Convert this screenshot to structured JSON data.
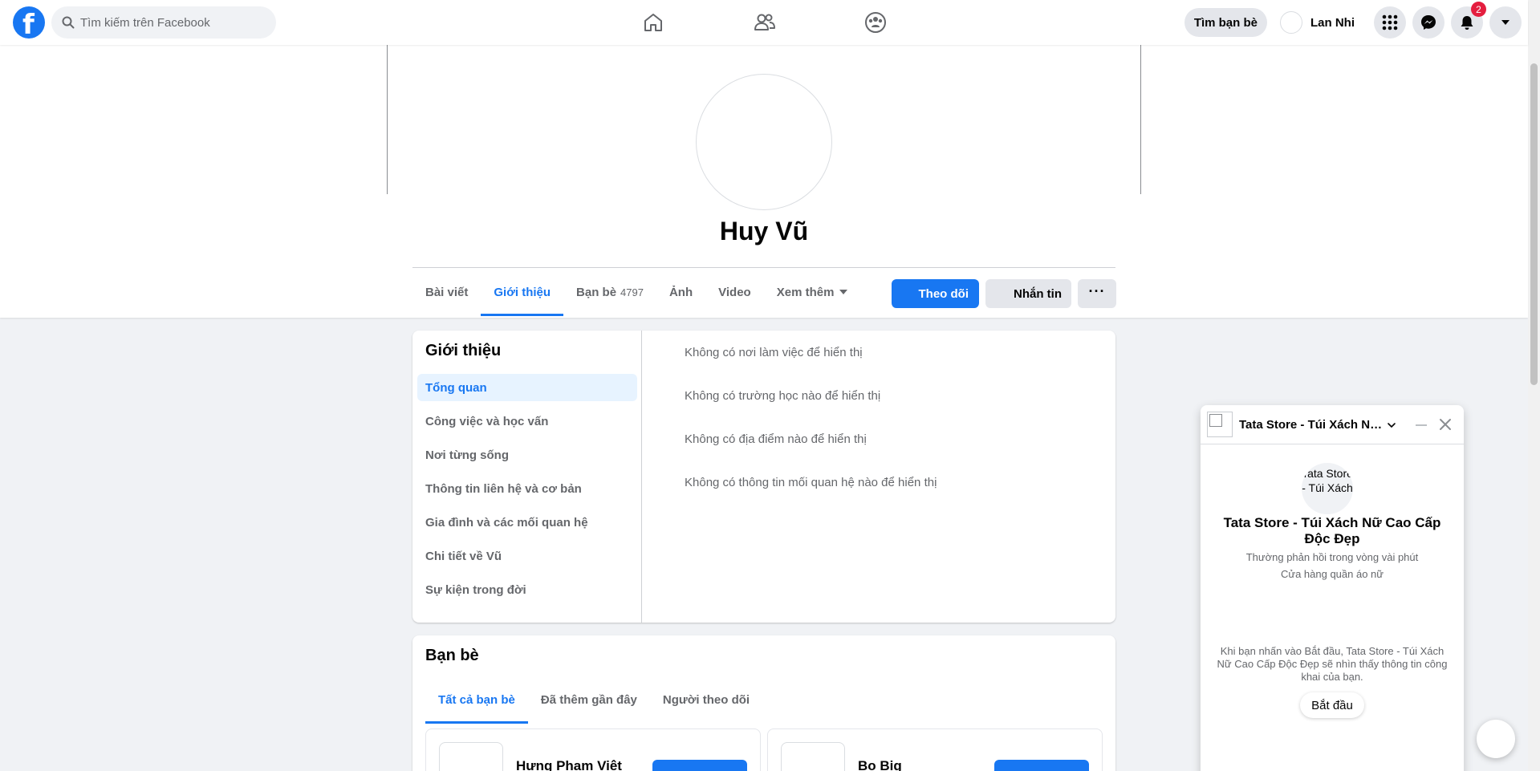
{
  "topbar": {
    "search_placeholder": "Tìm kiếm trên Facebook",
    "find_friends": "Tìm bạn bè",
    "user_name": "Lan Nhi",
    "notifications_count": "2"
  },
  "profile": {
    "name": "Huy Vũ",
    "tabs": [
      {
        "label": "Bài viết"
      },
      {
        "label": "Giới thiệu"
      },
      {
        "label": "Bạn bè",
        "count": "4797"
      },
      {
        "label": "Ảnh"
      },
      {
        "label": "Video"
      },
      {
        "label": "Xem thêm"
      }
    ],
    "follow_label": "Theo dõi",
    "message_label": "Nhắn tin",
    "more_label": "···"
  },
  "intro": {
    "title": "Giới thiệu",
    "menu": [
      "Tổng quan",
      "Công việc và học vấn",
      "Nơi từng sống",
      "Thông tin liên hệ và cơ bản",
      "Gia đình và các mối quan hệ",
      "Chi tiết về Vũ",
      "Sự kiện trong đời"
    ],
    "lines": [
      "Không có nơi làm việc để hiển thị",
      "Không có trường học nào để hiển thị",
      "Không có địa điểm nào để hiển thị",
      "Không có thông tin mối quan hệ nào để hiển thị"
    ]
  },
  "friends": {
    "title": "Bạn bè",
    "tabs": [
      "Tất cả bạn bè",
      "Đã thêm gần đây",
      "Người theo dõi"
    ],
    "items": [
      {
        "name": "Hưng Phạm Việt"
      },
      {
        "name": "Bo Big"
      }
    ]
  },
  "chat": {
    "title": "Tata Store - Túi Xách Nữ Cao Cấp Độc Đẹp",
    "logo_alt": "Tata Store - Túi Xách",
    "page_name": "Tata Store - Túi Xách Nữ Cao Cấp Độc Đẹp",
    "response_time": "Thường phản hồi trong vòng vài phút",
    "category": "Cửa hàng quần áo nữ",
    "note": "Khi bạn nhấn vào Bắt đầu, Tata Store - Túi Xách Nữ Cao Cấp Độc Đẹp sẽ nhìn thấy thông tin công khai của bạn.",
    "start_label": "Bắt đầu"
  },
  "colors": {
    "brand": "#1877f2",
    "page_bg": "#f0f2f5",
    "badge": "#e41e3f"
  },
  "icons": [
    "facebook-logo",
    "search-icon",
    "home-icon",
    "friends-icon",
    "groups-icon",
    "menu-grid-icon",
    "messenger-icon",
    "bell-icon",
    "account-caret-icon",
    "chevron-down-icon",
    "minimize-icon",
    "close-icon",
    "new-message-icon"
  ]
}
